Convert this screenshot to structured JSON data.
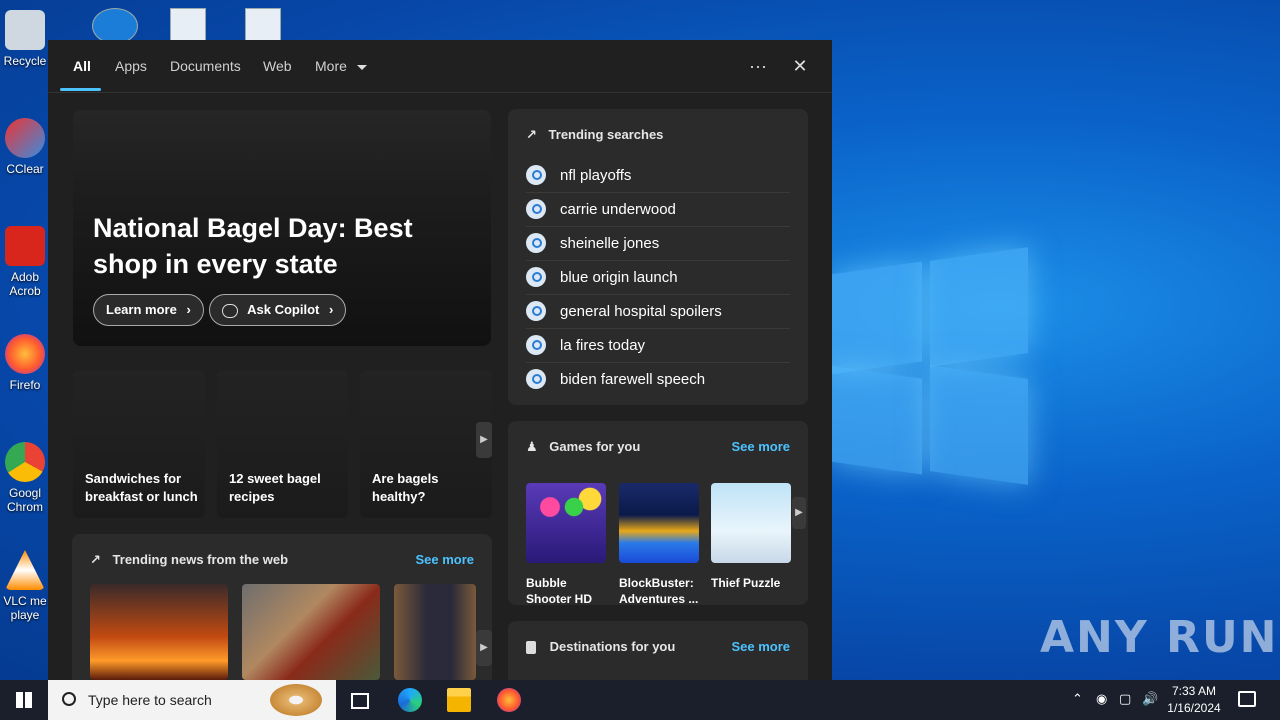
{
  "desktop": {
    "icons": [
      {
        "name": "recycle-bin",
        "label": "Recycle"
      },
      {
        "name": "ccleaner",
        "label": "CClear"
      },
      {
        "name": "adobe-acrobat",
        "label": "Adob Acrob"
      },
      {
        "name": "firefox",
        "label": "Firefo"
      },
      {
        "name": "google-chrome",
        "label": "Googl Chrom"
      },
      {
        "name": "vlc",
        "label": "VLC me playe"
      }
    ],
    "watermark": "ANY RUN"
  },
  "search": {
    "tabs": [
      "All",
      "Apps",
      "Documents",
      "Web",
      "More"
    ],
    "active_tab": "All",
    "hero": {
      "title": "National Bagel Day: Best shop in every state",
      "learn_more": "Learn more",
      "ask_copilot": "Ask Copilot"
    },
    "cards": [
      "Sandwiches for breakfast or lunch",
      "12 sweet bagel recipes",
      "Are bagels healthy?"
    ],
    "trending_searches": {
      "title": "Trending searches",
      "items": [
        "nfl playoffs",
        "carrie underwood",
        "sheinelle jones",
        "blue origin launch",
        "general hospital spoilers",
        "la fires today",
        "biden farewell speech"
      ]
    },
    "games": {
      "title": "Games for you",
      "see_more": "See more",
      "items": [
        "Bubble Shooter HD",
        "BlockBuster: Adventures ...",
        "Thief Puzzle"
      ]
    },
    "news": {
      "title": "Trending news from the web",
      "see_more": "See more"
    },
    "destinations": {
      "title": "Destinations for you",
      "see_more": "See more"
    }
  },
  "taskbar": {
    "search_placeholder": "Type here to search",
    "time": "7:33 AM",
    "date": "1/16/2024"
  },
  "colors": {
    "accent": "#4cc2ff",
    "panel_bg": "#202020",
    "box_bg": "#2b2b2b"
  }
}
